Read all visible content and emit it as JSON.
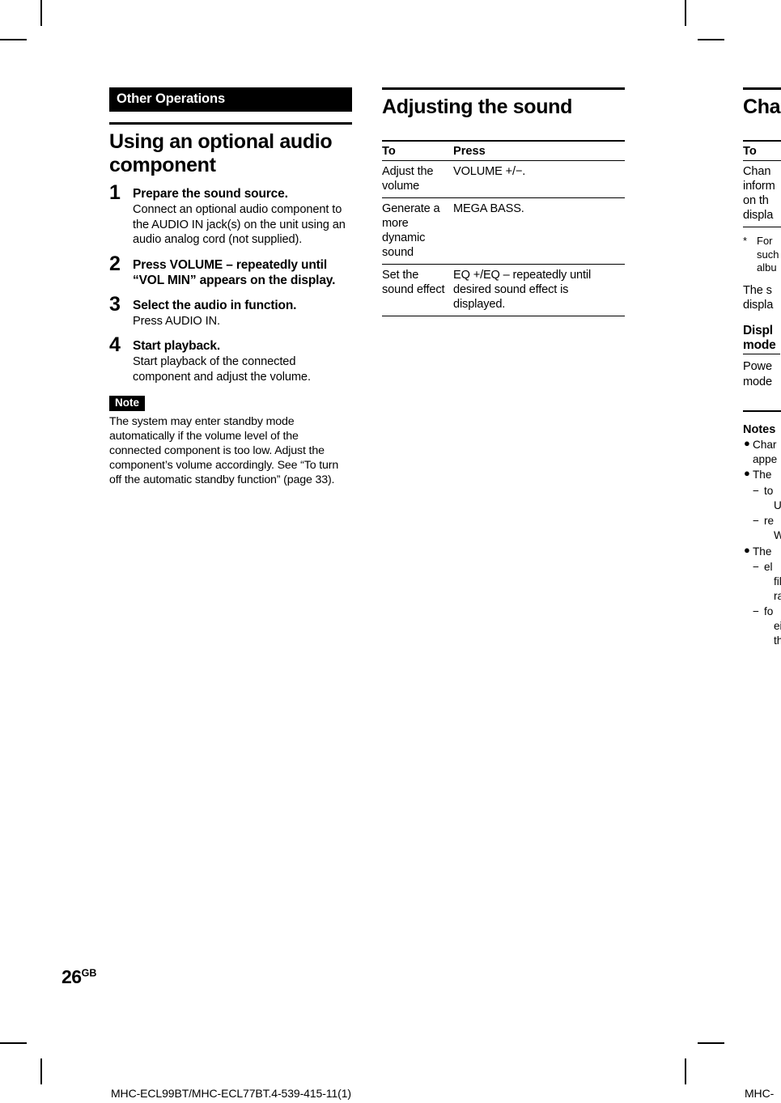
{
  "page": {
    "folio_number": "26",
    "folio_suffix": "GB",
    "model_code_left": "MHC-ECL99BT/MHC-ECL77BT.4-539-415-11(1)",
    "model_code_right": "MHC-"
  },
  "column_left": {
    "chapter_banner": "Other Operations",
    "section_title": "Using an optional audio component",
    "steps": [
      {
        "number": "1",
        "title": "Prepare the sound source.",
        "body": "Connect an optional audio component to the AUDIO IN jack(s) on the unit using an audio analog cord (not supplied)."
      },
      {
        "number": "2",
        "title": "Press VOLUME – repeatedly until “VOL MIN” appears on the display.",
        "body": ""
      },
      {
        "number": "3",
        "title": "Select the audio in function.",
        "body": "Press AUDIO IN."
      },
      {
        "number": "4",
        "title": "Start playback.",
        "body": "Start playback of the connected component and adjust the volume."
      }
    ],
    "note": {
      "badge": "Note",
      "text": "The system may enter standby mode automatically if the volume level of the connected component is too low. Adjust the component’s volume accordingly. See “To turn off the automatic standby function” (page 33)."
    }
  },
  "column_middle": {
    "section_title": "Adjusting the sound",
    "table": {
      "headers": [
        "To",
        "Press"
      ],
      "rows": [
        {
          "to": "Adjust the volume",
          "press": "VOLUME +/−."
        },
        {
          "to": "Generate a more dynamic sound",
          "press": "MEGA BASS."
        },
        {
          "to": "Set the sound effect",
          "press": "EQ +/EQ – repeatedly until desired sound effect is displayed."
        }
      ]
    }
  },
  "column_right_clipped": {
    "section_title": "Chan",
    "table": {
      "headers": [
        "To"
      ],
      "rows": [
        {
          "to": "Chan\ninform\non th\ndispla"
        }
      ]
    },
    "footnote": {
      "marker": "*",
      "lines": [
        "For ",
        "such",
        "albu"
      ]
    },
    "paragraph_lines": [
      "The s",
      "displa"
    ],
    "sub_head_lines": [
      "Displ",
      "mode"
    ],
    "sub_body_lines": [
      "Powe",
      "mode"
    ],
    "notes_head": "Notes",
    "notes": [
      {
        "type": "bullet",
        "lines": [
          "Char",
          "appe"
        ]
      },
      {
        "type": "bullet",
        "lines": [
          "The "
        ]
      },
      {
        "type": "dash",
        "lines": [
          "to",
          "U:"
        ]
      },
      {
        "type": "dash",
        "lines": [
          "re",
          "W"
        ]
      },
      {
        "type": "bullet",
        "lines": [
          "The "
        ]
      },
      {
        "type": "dash",
        "lines": [
          "el",
          "fil",
          "ra"
        ]
      },
      {
        "type": "dash",
        "lines": [
          "fo",
          "ei",
          "th"
        ]
      }
    ]
  }
}
